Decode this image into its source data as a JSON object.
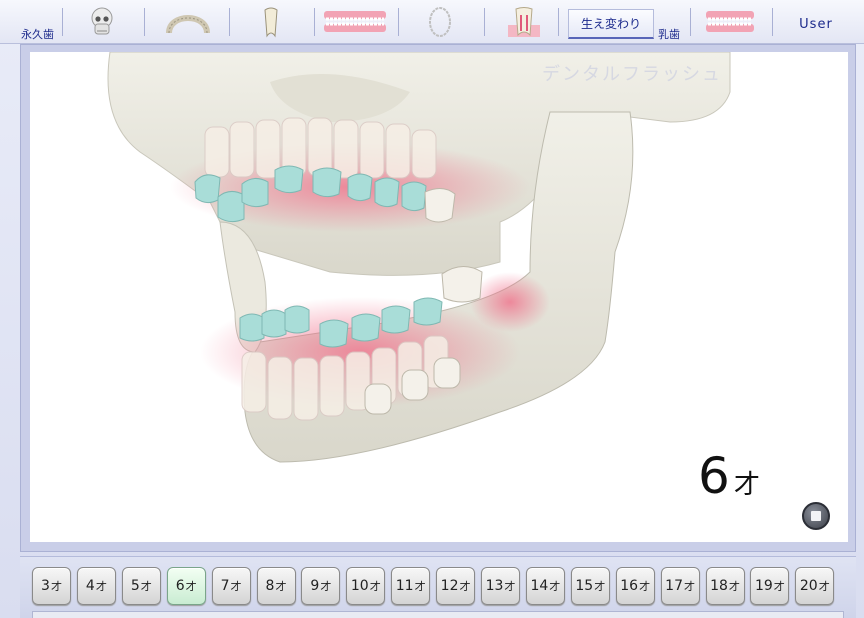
{
  "toolbar": {
    "permanent_label": "永久歯",
    "primary_label": "乳歯",
    "eruption_button": "生え変わり",
    "user_button": "User",
    "icons": [
      "skull-icon",
      "dental-arch-icon",
      "tooth-icon",
      "teeth-row-icon",
      "ring-arch-icon",
      "tooth-cross-section-icon",
      "primary-teeth-row-icon"
    ]
  },
  "viewer": {
    "watermark": "デンタルフラッシュ",
    "age_value": "6",
    "age_unit": "才"
  },
  "age_buttons": {
    "unit": "才",
    "items": [
      "3",
      "4",
      "5",
      "6",
      "7",
      "8",
      "9",
      "10",
      "11",
      "12",
      "13",
      "14",
      "15",
      "16",
      "17",
      "18",
      "19",
      "20"
    ],
    "selected": "6"
  },
  "colors": {
    "accent": "#1c2a8c",
    "gum_highlight": "#f06a86",
    "erupting_teeth": "#a7ddd9",
    "bone": "#ecebe3"
  }
}
